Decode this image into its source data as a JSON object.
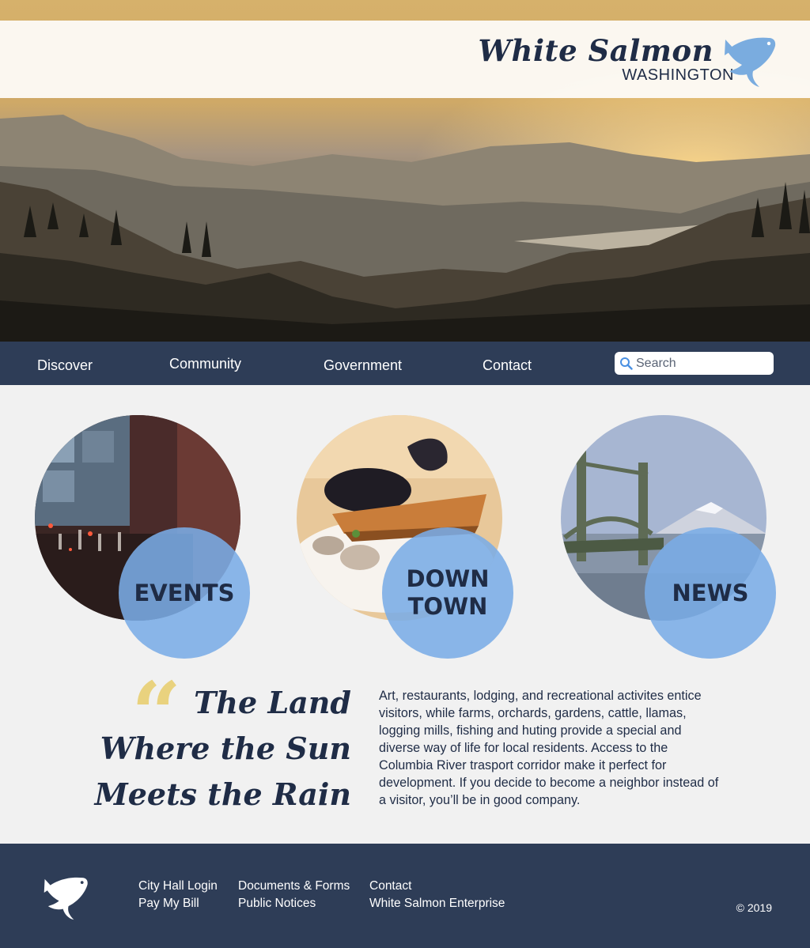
{
  "brand": {
    "title": "White Salmon",
    "subtitle": "WASHINGTON",
    "logo_icon": "salmon-icon",
    "logo_color": "#7aacdf"
  },
  "nav": {
    "items": [
      {
        "label": "Discover"
      },
      {
        "label": "Community"
      },
      {
        "label": "Government"
      },
      {
        "label": "Contact"
      }
    ],
    "search": {
      "placeholder": "Search",
      "value": ""
    }
  },
  "features": [
    {
      "label_line1": "EVENTS",
      "label_line2": ""
    },
    {
      "label_line1": "DOWN",
      "label_line2": "TOWN"
    },
    {
      "label_line1": "NEWS",
      "label_line2": ""
    }
  ],
  "quote": {
    "mark": "“",
    "line1": "The Land",
    "line2": "Where the Sun",
    "line3": "Meets the Rain"
  },
  "intro": {
    "text": "Art, restaurants, lodging, and recreational activites entice visitors, while farms, orchards, gardens, cattle, llamas, logging mills, fishing and huting provide a special and diverse way of life for local residents. Access to the Columbia River trasport corridor make it perfect for development. If you decide to become a neighbor instead of a visitor, you’ll be in good company."
  },
  "footer": {
    "columns": [
      [
        "City Hall Login",
        "Pay My Bill"
      ],
      [
        "Documents & Forms",
        "Public Notices"
      ],
      [
        "Contact",
        "White Salmon Enterprise"
      ]
    ],
    "copyright": "© 2019"
  },
  "colors": {
    "navy": "#2e3d57",
    "badge_blue": "#7aacdf",
    "quote_gold": "#e9d27e",
    "background": "#f1f1f1"
  }
}
